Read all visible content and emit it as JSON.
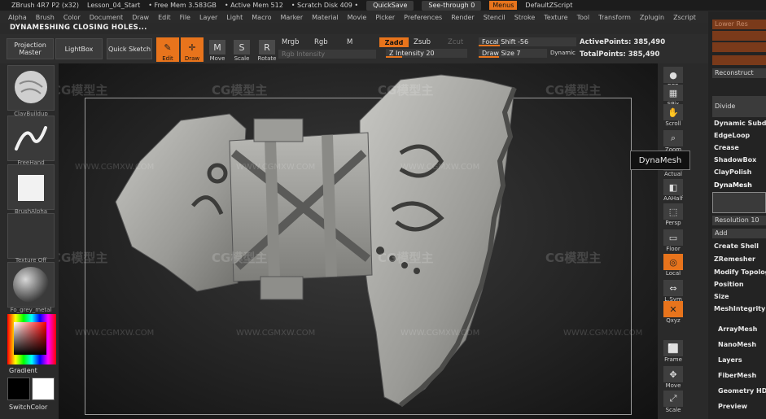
{
  "titlebar": {
    "app": "ZBrush 4R7 P2 (x32)",
    "document": "Lesson_04_Start",
    "free_mem": "• Free Mem 3.583GB",
    "active_mem": "• Active Mem 512",
    "scratch": "• Scratch Disk 409 •",
    "quicksave": "QuickSave",
    "seethrough": "See-through 0",
    "menus": "Menus",
    "script": "DefaultZScript"
  },
  "menubar": [
    "Alpha",
    "Brush",
    "Color",
    "Document",
    "Draw",
    "Edit",
    "File",
    "Layer",
    "Light",
    "Macro",
    "Marker",
    "Material",
    "Movie",
    "Picker",
    "Preferences",
    "Render",
    "Stencil",
    "Stroke",
    "Texture",
    "Tool",
    "Transform",
    "Zplugin",
    "Zscript"
  ],
  "notice": "DYNAMESHING CLOSING HOLES...",
  "toolbar": {
    "projection_master": "Projection Master",
    "lightbox": "LightBox",
    "quick_sketch": "Quick Sketch",
    "edit": "Edit",
    "draw": "Draw",
    "move": "Move",
    "scale": "Scale",
    "rotate": "Rotate",
    "mrgb": "Mrgb",
    "rgb": "Rgb",
    "m": "M",
    "rgb_intensity": "Rgb Intensity",
    "zadd": "Zadd",
    "zsub": "Zsub",
    "zcut": "Zcut",
    "z_intensity": "Z Intensity 20",
    "focal_shift": "Focal Shift -56",
    "draw_size": "Draw Size 7",
    "dynamic": "Dynamic",
    "active_points": "ActivePoints: 385,490",
    "total_points": "TotalPoints: 385,490"
  },
  "left_shelf": [
    {
      "label": "ClayBuildup"
    },
    {
      "label": "FreeHand"
    },
    {
      "label": "BrushAlpha"
    },
    {
      "label": "Texture Off"
    },
    {
      "label": "Fo_grey_metal"
    }
  ],
  "gradient_label": "Gradient",
  "switchcolor_label": "SwitchColor",
  "right_shelf": [
    {
      "icon": "bpr-icon",
      "label": "BPR"
    },
    {
      "icon": "spix-icon",
      "label": "SPix"
    },
    {
      "icon": "scroll-icon",
      "label": "Scroll"
    },
    {
      "icon": "zoom-icon",
      "label": "Zoom"
    },
    {
      "icon": "actual-icon",
      "label": "Actual"
    },
    {
      "icon": "aahalf-icon",
      "label": "AAHalf"
    },
    {
      "icon": "persp-icon",
      "label": "Persp"
    },
    {
      "icon": "floor-icon",
      "label": "Floor"
    },
    {
      "icon": "local-icon",
      "label": "Local"
    },
    {
      "icon": "lsym-icon",
      "label": "L.Sym"
    },
    {
      "icon": "xyz-icon",
      "label": "Qxyz"
    },
    {
      "icon": "frame-icon",
      "label": "Frame"
    },
    {
      "icon": "move-icon",
      "label": "Move"
    },
    {
      "icon": "scale-icon",
      "label": "Scale"
    }
  ],
  "tooltip": "DynaMesh",
  "right_panel": {
    "lower_res": "Lower Res",
    "reconstruct": "Reconstruct",
    "divide": "Divide",
    "dynamic_subdiv": "Dynamic Subdiv",
    "edgeloop": "EdgeLoop",
    "crease": "Crease",
    "shadowbox": "ShadowBox",
    "claypolish": "ClayPolish",
    "dynamesh": "DynaMesh",
    "resolution": "Resolution 10",
    "add": "Add",
    "create_shell": "Create Shell",
    "zremesher": "ZRemesher",
    "modify_topology": "Modify Topology",
    "position": "Position",
    "size": "Size",
    "meshintegrity": "MeshIntegrity",
    "arraymesh": "ArrayMesh",
    "nanomesh": "NanoMesh",
    "layers": "Layers",
    "fibermesh": "FiberMesh",
    "geometry_hd": "Geometry HD",
    "preview": "Preview"
  },
  "watermark": {
    "brand": "CG模型主",
    "url": "WWW.CGMXW.COM"
  },
  "colors": {
    "accent": "#e8741c"
  }
}
